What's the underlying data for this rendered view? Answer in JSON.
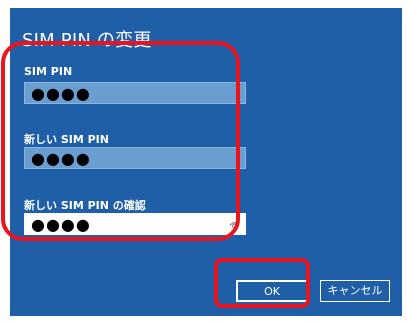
{
  "dialog": {
    "title": "SIM PIN の変更",
    "background_color": "#1f5fa8",
    "highlight_color": "#e8141e"
  },
  "fields": [
    {
      "label": "SIM PIN",
      "value": "●●●●"
    },
    {
      "label": "新しい SIM PIN",
      "value": "●●●●"
    },
    {
      "label": "新しい SIM PIN の確認",
      "value": "●●●●",
      "icon": "reveal-password-icon"
    }
  ],
  "buttons": {
    "ok_label": "OK",
    "cancel_label": "キャンセル"
  }
}
